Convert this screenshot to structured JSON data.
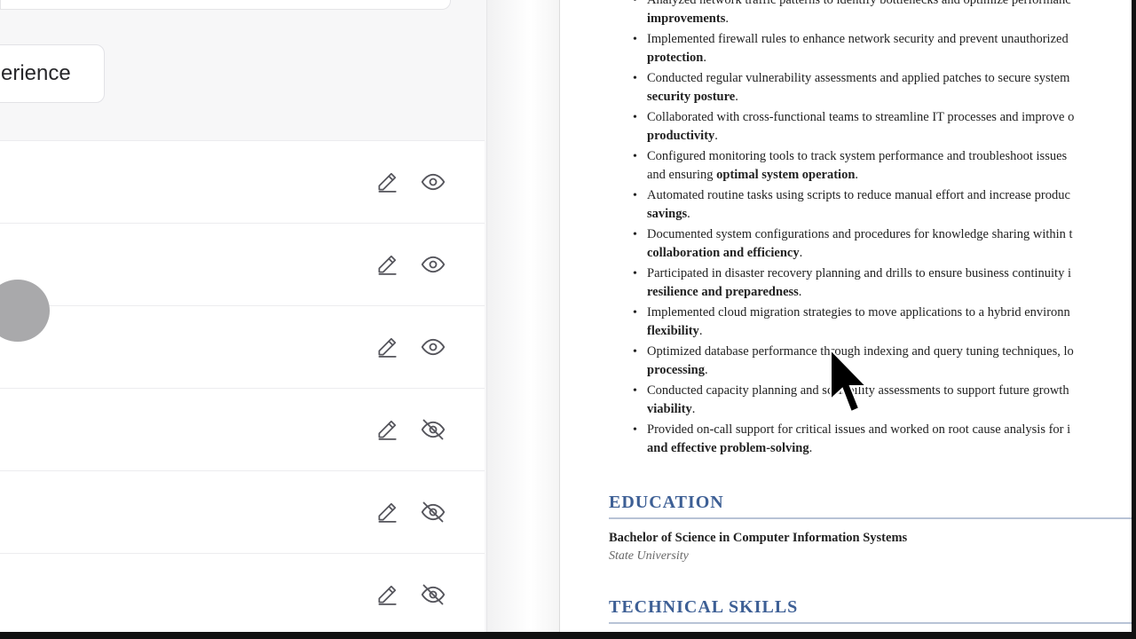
{
  "editor": {
    "section_label": "erience",
    "rows": [
      {
        "visible": true
      },
      {
        "visible": true
      },
      {
        "visible": true
      },
      {
        "visible": false
      },
      {
        "visible": false
      },
      {
        "visible": false
      }
    ]
  },
  "preview": {
    "bullets": [
      {
        "text": "Analyzed network traffic patterns to identify bottlenecks and optimize performanc",
        "bold": "improvements",
        "tail": "."
      },
      {
        "text": "Implemented firewall rules to enhance network security and prevent unauthorized",
        "bold": "protection",
        "tail": "."
      },
      {
        "text": "Conducted regular vulnerability assessments and applied patches to secure system",
        "bold": "security posture",
        "tail": "."
      },
      {
        "text": "Collaborated with cross-functional teams to streamline IT processes and improve o",
        "bold": "productivity",
        "tail": "."
      },
      {
        "text": "Configured monitoring tools to track system performance and troubleshoot issues",
        "pre2": "and ensuring ",
        "bold": "optimal system operation",
        "tail": "."
      },
      {
        "text": "Automated routine tasks using scripts to reduce manual effort and increase produc",
        "bold": "savings",
        "tail": "."
      },
      {
        "text": "Documented system configurations and procedures for knowledge sharing within t",
        "bold": "collaboration and efficiency",
        "tail": "."
      },
      {
        "text": "Participated in disaster recovery planning and drills to ensure business continuity i",
        "bold": "resilience and preparedness",
        "tail": "."
      },
      {
        "text": "Implemented cloud migration strategies to move applications to a hybrid environn",
        "bold": "flexibility",
        "tail": "."
      },
      {
        "text": "Optimized database performance through indexing and query tuning techniques, lo",
        "bold": "processing",
        "tail": "."
      },
      {
        "text": "Conducted capacity planning and scalability assessments to support future growth",
        "bold": "viability",
        "tail": "."
      },
      {
        "text": "Provided on-call support for critical issues and worked on root cause analysis for i",
        "bold": "and effective problem-solving",
        "tail": "."
      }
    ],
    "education_heading": "EDUCATION",
    "degree": "Bachelor of Science in Computer Information Systems",
    "school": "State University",
    "skills_heading": "TECHNICAL SKILLS"
  },
  "colors": {
    "heading": "#3d5f95",
    "icon": "#55555c"
  },
  "icons": {
    "edit": "pencil-icon",
    "visible": "eye-icon",
    "hidden": "eye-off-icon"
  }
}
